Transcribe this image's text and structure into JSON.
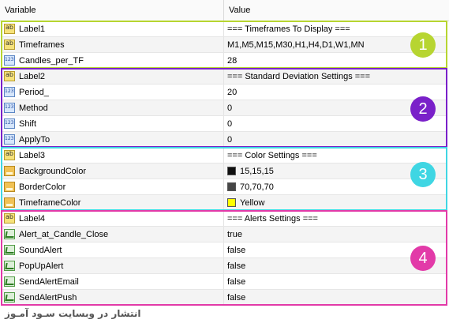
{
  "header": {
    "variable": "Variable",
    "value": "Value"
  },
  "groups": [
    {
      "badge": "1",
      "color": "#b7d531"
    },
    {
      "badge": "2",
      "color": "#7a20c9"
    },
    {
      "badge": "3",
      "color": "#3fd6e3"
    },
    {
      "badge": "4",
      "color": "#e23aa8"
    }
  ],
  "rows": [
    {
      "name": "Label1",
      "value": "=== Timeframes To Display ===",
      "icon": "ab-icon"
    },
    {
      "name": "Timeframes",
      "value": "M1,M5,M15,M30,H1,H4,D1,W1,MN",
      "icon": "ab-icon"
    },
    {
      "name": "Candles_per_TF",
      "value": "28",
      "icon": "number-icon"
    },
    {
      "name": "Label2",
      "value": "=== Standard Deviation Settings ===",
      "icon": "ab-icon"
    },
    {
      "name": "Period_",
      "value": "20",
      "icon": "number-icon"
    },
    {
      "name": "Method",
      "value": "0",
      "icon": "number-icon"
    },
    {
      "name": "Shift",
      "value": "0",
      "icon": "number-icon"
    },
    {
      "name": "ApplyTo",
      "value": "0",
      "icon": "number-icon"
    },
    {
      "name": "Label3",
      "value": "=== Color Settings ===",
      "icon": "ab-icon"
    },
    {
      "name": "BackgroundColor",
      "value": "15,15,15",
      "icon": "color-icon",
      "swatch": "#0f0f0f"
    },
    {
      "name": "BorderColor",
      "value": "70,70,70",
      "icon": "color-icon",
      "swatch": "#464646"
    },
    {
      "name": "TimeframeColor",
      "value": "Yellow",
      "icon": "color-icon",
      "swatch": "#ffff00"
    },
    {
      "name": "Label4",
      "value": "=== Alerts Settings ===",
      "icon": "ab-icon"
    },
    {
      "name": "Alert_at_Candle_Close",
      "value": "true",
      "icon": "bool-icon"
    },
    {
      "name": "SoundAlert",
      "value": "false",
      "icon": "bool-icon"
    },
    {
      "name": "PopUpAlert",
      "value": "false",
      "icon": "bool-icon"
    },
    {
      "name": "SendAlertEmail",
      "value": "false",
      "icon": "bool-icon"
    },
    {
      "name": "SendAlertPush",
      "value": "false",
      "icon": "bool-icon"
    }
  ],
  "watermark": "انتشار در وبسایت سـود آمـوز"
}
